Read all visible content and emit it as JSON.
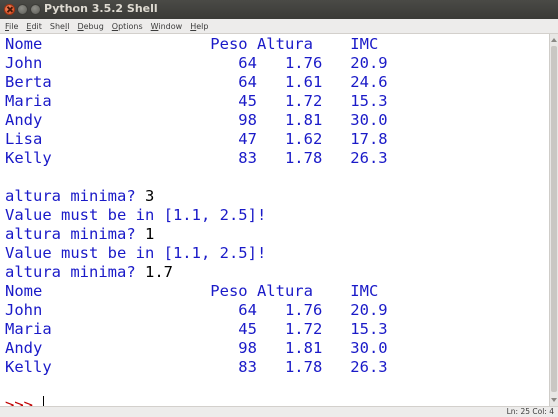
{
  "window": {
    "title": "Python 3.5.2 Shell"
  },
  "menu": [
    {
      "pre": "",
      "u": "F",
      "post": "ile"
    },
    {
      "pre": "",
      "u": "E",
      "post": "dit"
    },
    {
      "pre": "She",
      "u": "l",
      "post": "l"
    },
    {
      "pre": "",
      "u": "D",
      "post": "ebug"
    },
    {
      "pre": "",
      "u": "O",
      "post": "ptions"
    },
    {
      "pre": "",
      "u": "W",
      "post": "indow"
    },
    {
      "pre": "",
      "u": "H",
      "post": "elp"
    }
  ],
  "shell": {
    "lines": [
      {
        "kind": "out",
        "text": "Nome                  Peso Altura    IMC"
      },
      {
        "kind": "out",
        "text": "John                     64   1.76   20.9"
      },
      {
        "kind": "out",
        "text": "Berta                    64   1.61   24.6"
      },
      {
        "kind": "out",
        "text": "Maria                    45   1.72   15.3"
      },
      {
        "kind": "out",
        "text": "Andy                     98   1.81   30.0"
      },
      {
        "kind": "out",
        "text": "Lisa                     47   1.62   17.8"
      },
      {
        "kind": "out",
        "text": "Kelly                    83   1.78   26.3"
      },
      {
        "kind": "blank",
        "text": ""
      },
      {
        "kind": "io",
        "text": "altura minima? ",
        "input": "3"
      },
      {
        "kind": "out",
        "text": "Value must be in [1.1, 2.5]!"
      },
      {
        "kind": "io",
        "text": "altura minima? ",
        "input": "1"
      },
      {
        "kind": "out",
        "text": "Value must be in [1.1, 2.5]!"
      },
      {
        "kind": "io",
        "text": "altura minima? ",
        "input": "1.7"
      },
      {
        "kind": "out",
        "text": "Nome                  Peso Altura    IMC"
      },
      {
        "kind": "out",
        "text": "John                     64   1.76   20.9"
      },
      {
        "kind": "out",
        "text": "Maria                    45   1.72   15.3"
      },
      {
        "kind": "out",
        "text": "Andy                     98   1.81   30.0"
      },
      {
        "kind": "out",
        "text": "Kelly                    83   1.78   26.3"
      },
      {
        "kind": "blank",
        "text": ""
      },
      {
        "kind": "prompt",
        "text": ">>> "
      }
    ]
  },
  "status": {
    "text": "Ln: 25  Col: 4"
  },
  "colors": {
    "output": "#1a1ac8",
    "input": "#000000",
    "prompt": "#c00000"
  }
}
